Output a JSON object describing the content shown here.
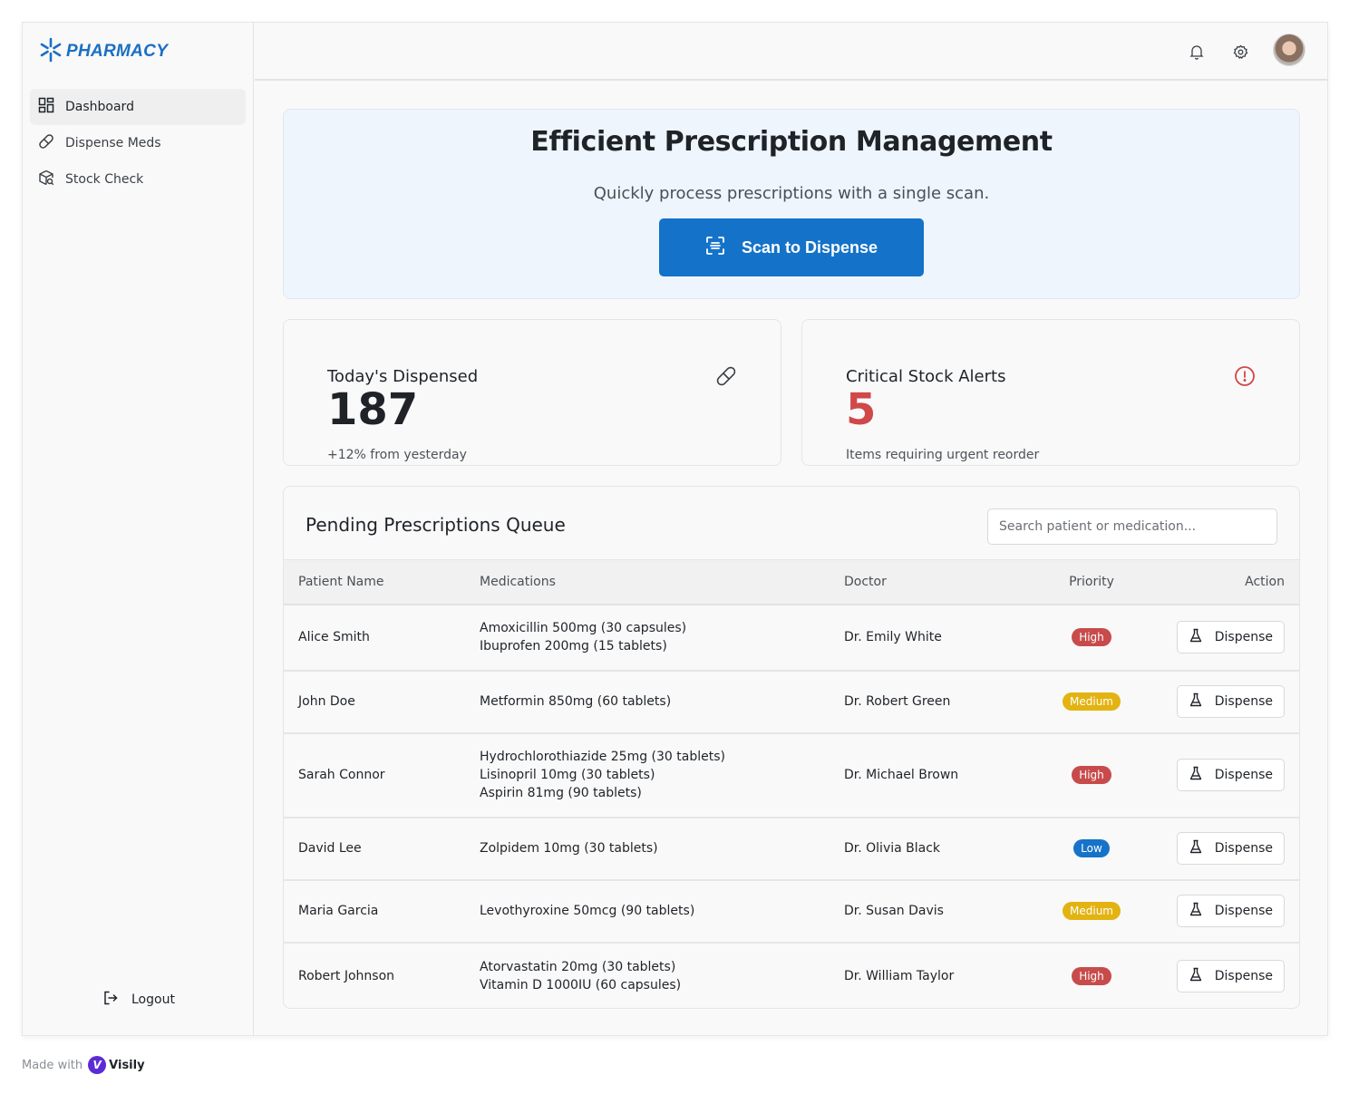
{
  "brand": {
    "name": "PHARMACY",
    "icon": "asterisk-logo-icon",
    "color": "#1a6fc4"
  },
  "sidebar": {
    "items": [
      {
        "label": "Dashboard",
        "icon": "grid-icon",
        "active": true
      },
      {
        "label": "Dispense Meds",
        "icon": "pill-icon",
        "active": false
      },
      {
        "label": "Stock Check",
        "icon": "package-search-icon",
        "active": false
      }
    ],
    "logout_label": "Logout"
  },
  "header": {
    "icons": [
      "bell-icon",
      "gear-icon",
      "avatar"
    ]
  },
  "hero": {
    "title": "Efficient Prescription Management",
    "subtitle": "Quickly process prescriptions with a single scan.",
    "button_label": "Scan to Dispense",
    "button_color": "#1473c9"
  },
  "stats": {
    "dispensed": {
      "label": "Today's Dispensed",
      "value": "187",
      "note": "+12% from yesterday",
      "icon": "pill-icon"
    },
    "alerts": {
      "label": "Critical Stock Alerts",
      "value": "5",
      "note": "Items requiring urgent reorder",
      "icon": "alert-circle-icon",
      "color": "#d04848"
    }
  },
  "queue": {
    "title": "Pending Prescriptions Queue",
    "search_placeholder": "Search patient or medication...",
    "columns": [
      "Patient Name",
      "Medications",
      "Doctor",
      "Priority",
      "Action"
    ],
    "rows": [
      {
        "patient": "Alice Smith",
        "meds": [
          "Amoxicillin 500mg (30 capsules)",
          "Ibuprofen 200mg (15 tablets)"
        ],
        "doctor": "Dr. Emily White",
        "priority": "High",
        "action": "Dispense"
      },
      {
        "patient": "John Doe",
        "meds": [
          "Metformin 850mg (60 tablets)"
        ],
        "doctor": "Dr. Robert Green",
        "priority": "Medium",
        "action": "Dispense"
      },
      {
        "patient": "Sarah Connor",
        "meds": [
          "Hydrochlorothiazide 25mg (30 tablets)",
          "Lisinopril 10mg (30 tablets)",
          "Aspirin 81mg (90 tablets)"
        ],
        "doctor": "Dr. Michael Brown",
        "priority": "High",
        "action": "Dispense"
      },
      {
        "patient": "David Lee",
        "meds": [
          "Zolpidem 10mg (30 tablets)"
        ],
        "doctor": "Dr. Olivia Black",
        "priority": "Low",
        "action": "Dispense"
      },
      {
        "patient": "Maria Garcia",
        "meds": [
          "Levothyroxine 50mcg (90 tablets)"
        ],
        "doctor": "Dr. Susan Davis",
        "priority": "Medium",
        "action": "Dispense"
      },
      {
        "patient": "Robert Johnson",
        "meds": [
          "Atorvastatin 20mg (30 tablets)",
          "Vitamin D 1000IU (60 capsules)"
        ],
        "doctor": "Dr. William Taylor",
        "priority": "High",
        "action": "Dispense"
      }
    ]
  },
  "footer": {
    "made_with": "Made with",
    "brand": "Visily"
  },
  "colors": {
    "high": "#c84b4b",
    "medium": "#e3b312",
    "low": "#1673c9"
  }
}
